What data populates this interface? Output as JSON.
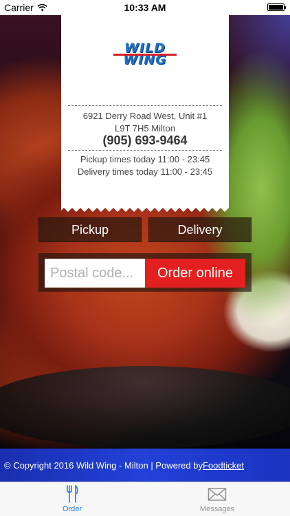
{
  "status_bar": {
    "carrier": "Carrier",
    "time": "10:33 AM"
  },
  "brand": {
    "logo_line1": "WILD",
    "logo_line2": "WING"
  },
  "receipt": {
    "address_line1": "6921 Derry Road West, Unit #1",
    "address_line2": "L9T 7H5 Milton",
    "phone": "(905) 693-9464",
    "pickup_times": "Pickup times today 11:00 - 23:45",
    "delivery_times": "Delivery times today 11:00 - 23:45"
  },
  "order_type": {
    "pickup_label": "Pickup",
    "delivery_label": "Delivery"
  },
  "order_form": {
    "postal_placeholder": "Postal code...",
    "postal_value": "",
    "order_button_label": "Order online"
  },
  "footer": {
    "copyright": "© Copyright 2016 Wild Wing - Milton | Powered by ",
    "powered_link": "Foodticket"
  },
  "tabbar": {
    "tabs": [
      {
        "label": "Order",
        "icon": "cutlery-icon",
        "active": true
      },
      {
        "label": "Messages",
        "icon": "envelope-icon",
        "active": false
      }
    ]
  },
  "colors": {
    "accent_red": "#e1201f",
    "footer_blue": "#2241d8",
    "tab_active": "#1a7cf5",
    "tab_inactive": "#929292"
  }
}
